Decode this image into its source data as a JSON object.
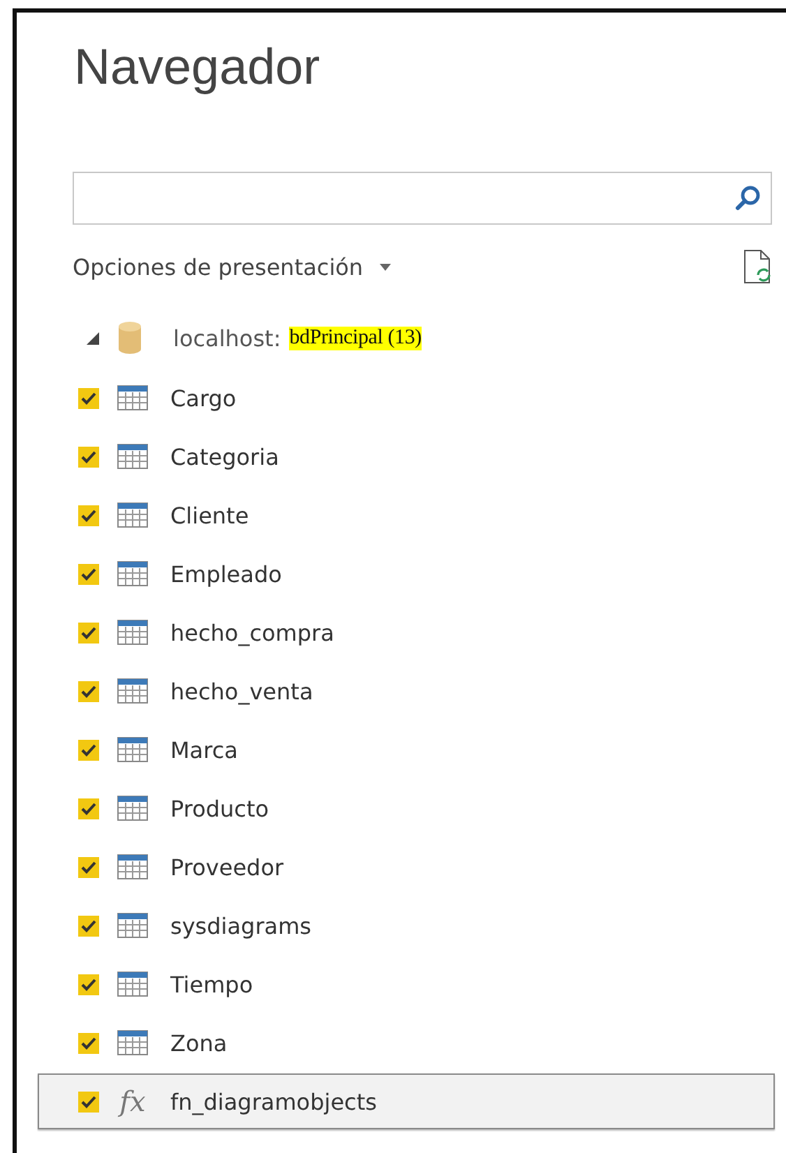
{
  "window": {
    "title": "Navegador"
  },
  "display_options": {
    "label": "Opciones de presentación"
  },
  "tree": {
    "root": {
      "label": "localhost:",
      "highlight": "bdPrincipal (13)",
      "expanded": true,
      "children": [
        {
          "label": "Cargo",
          "kind": "table",
          "checked": true,
          "selected": false
        },
        {
          "label": "Categoria",
          "kind": "table",
          "checked": true,
          "selected": false
        },
        {
          "label": "Cliente",
          "kind": "table",
          "checked": true,
          "selected": false
        },
        {
          "label": "Empleado",
          "kind": "table",
          "checked": true,
          "selected": false
        },
        {
          "label": "hecho_compra",
          "kind": "table",
          "checked": true,
          "selected": false
        },
        {
          "label": "hecho_venta",
          "kind": "table",
          "checked": true,
          "selected": false
        },
        {
          "label": "Marca",
          "kind": "table",
          "checked": true,
          "selected": false
        },
        {
          "label": "Producto",
          "kind": "table",
          "checked": true,
          "selected": false
        },
        {
          "label": "Proveedor",
          "kind": "table",
          "checked": true,
          "selected": false
        },
        {
          "label": "sysdiagrams",
          "kind": "table",
          "checked": true,
          "selected": false
        },
        {
          "label": "Tiempo",
          "kind": "table",
          "checked": true,
          "selected": false
        },
        {
          "label": "Zona",
          "kind": "table",
          "checked": true,
          "selected": false
        },
        {
          "label": "fn_diagramobjects",
          "kind": "function",
          "glyph": "fx",
          "checked": true,
          "selected": true
        }
      ]
    }
  }
}
